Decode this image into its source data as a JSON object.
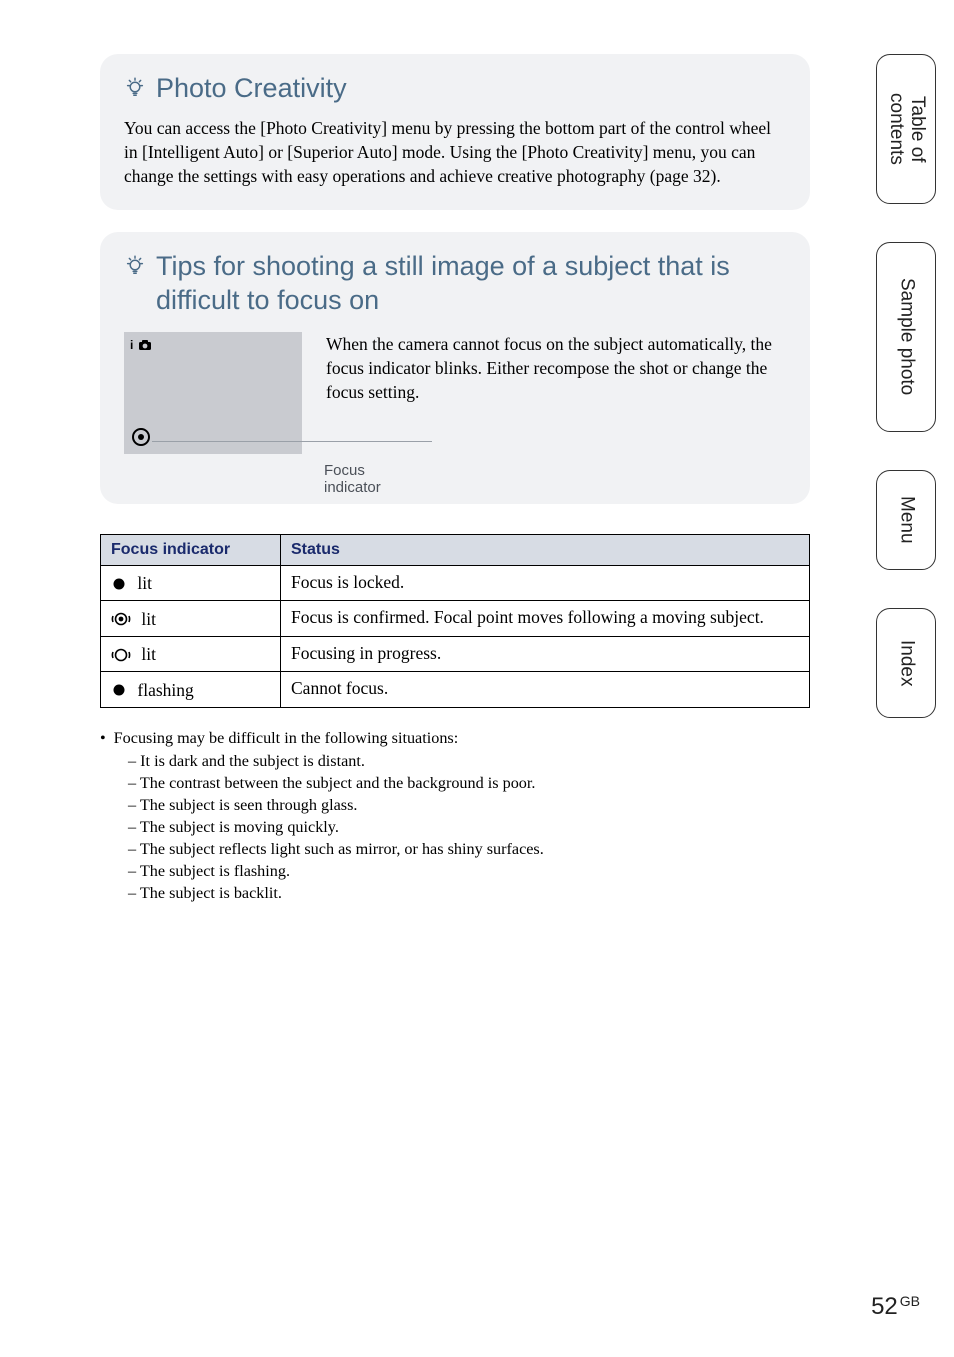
{
  "side_tabs": {
    "toc": "Table of\ncontents",
    "sample": "Sample photo",
    "menu": "Menu",
    "index": "Index"
  },
  "card1": {
    "title": "Photo Creativity",
    "body": "You can access the [Photo Creativity] menu by pressing the bottom part of the control wheel in [Intelligent Auto] or [Superior Auto] mode. Using the [Photo Creativity] menu, you can change the settings with easy operations and achieve creative photography (page 32)."
  },
  "card2": {
    "title": "Tips for shooting a still image of a subject that is difficult to focus on",
    "paragraph": "When the camera cannot focus on the subject automatically, the focus indicator blinks. Either recompose the shot or change the focus setting.",
    "vf_mode_label": "i",
    "caption": "Focus indicator"
  },
  "table": {
    "headers": {
      "indicator": "Focus indicator",
      "status": "Status"
    },
    "rows": [
      {
        "state": "lit",
        "status": "Focus is locked."
      },
      {
        "state": "lit",
        "status": "Focus is confirmed. Focal point moves following a moving subject."
      },
      {
        "state": "lit",
        "status": "Focusing in progress."
      },
      {
        "state": "flashing",
        "status": "Cannot focus."
      }
    ]
  },
  "bullets": {
    "lead": "Focusing may be difficult in the following situations:",
    "items": [
      "It is dark and the subject is distant.",
      "The contrast between the subject and the background is poor.",
      "The subject is seen through glass.",
      "The subject is moving quickly.",
      "The subject reflects light such as mirror, or has shiny surfaces.",
      "The subject is flashing.",
      "The subject is backlit."
    ]
  },
  "page_number": {
    "num": "52",
    "suffix": "GB"
  }
}
